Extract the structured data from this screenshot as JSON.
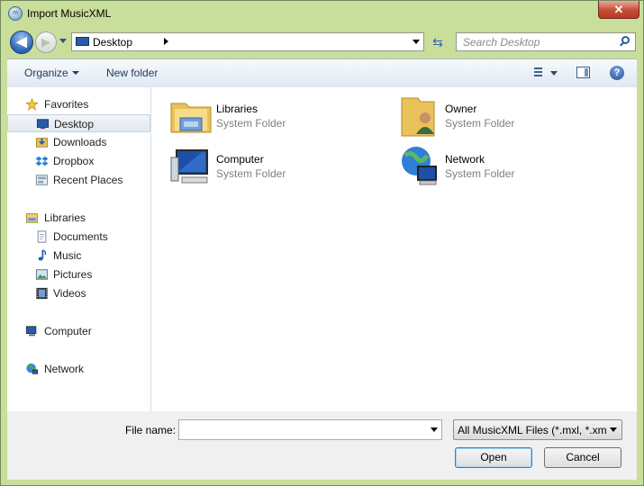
{
  "window": {
    "title": "Import MusicXML",
    "close_glyph": "✕",
    "app_icon_text": "m"
  },
  "navbar": {
    "back_glyph": "◀",
    "forward_glyph": "▶",
    "address": "Desktop",
    "refresh_glyph": "⇆",
    "search_placeholder": "Search Desktop"
  },
  "toolbar": {
    "organize": "Organize",
    "new_folder": "New folder",
    "help": "?"
  },
  "sidebar": {
    "favorites": "Favorites",
    "desktop": "Desktop",
    "downloads": "Downloads",
    "dropbox": "Dropbox",
    "recent_places": "Recent Places",
    "libraries": "Libraries",
    "documents": "Documents",
    "music": "Music",
    "pictures": "Pictures",
    "videos": "Videos",
    "computer": "Computer",
    "network": "Network"
  },
  "items": [
    {
      "name": "Libraries",
      "type": "System Folder",
      "icon": "libraries-folder-icon"
    },
    {
      "name": "Owner",
      "type": "System Folder",
      "icon": "user-folder-icon"
    },
    {
      "name": "Computer",
      "type": "System Folder",
      "icon": "computer-icon"
    },
    {
      "name": "Network",
      "type": "System Folder",
      "icon": "network-icon"
    }
  ],
  "footer": {
    "file_name_label": "File name:",
    "file_name_value": "",
    "filter": "All MusicXML Files (*.mxl, *.xml)",
    "open": "Open",
    "cancel": "Cancel"
  },
  "colors": {
    "frame": "#c9de9b",
    "close": "#c74c36",
    "accent": "#2a64b8"
  }
}
